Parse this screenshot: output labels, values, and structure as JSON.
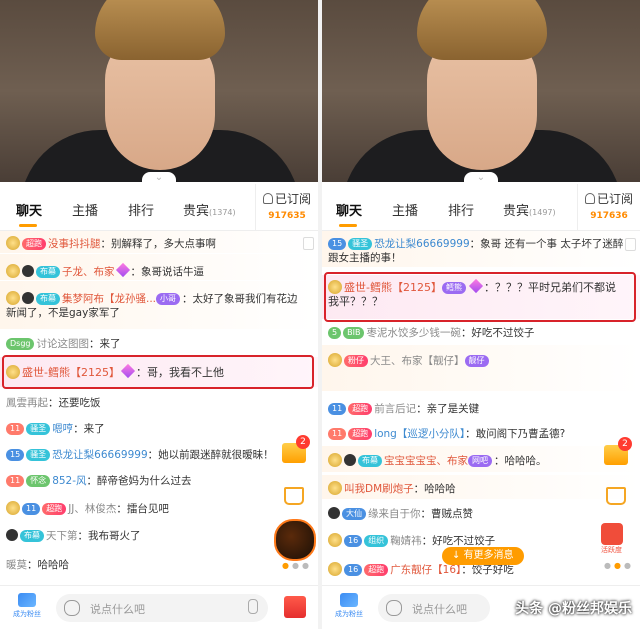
{
  "colors": {
    "accent": "#ff9c00",
    "highlight_border": "#d8232a",
    "subscribe_count": "#ff8a00"
  },
  "left": {
    "tabs": [
      {
        "label": "聊天",
        "active": true
      },
      {
        "label": "主播"
      },
      {
        "label": "排行"
      },
      {
        "label": "贵宾",
        "count": "(1374)"
      }
    ],
    "subscribe": {
      "label": "已订阅",
      "count": "917635"
    },
    "messages": [
      {
        "badge": "超跑",
        "name": "没事抖抖腿",
        "text": "：别解释了，多大点事啊"
      },
      {
        "badge": "布幕",
        "name": "子龙、布家",
        "text": "：象哥说话牛逼"
      },
      {
        "badge": "布幕",
        "name": "集梦阿布【龙孙骚...",
        "badge2": "小哥",
        "text": "：太好了象哥我们有花边新闻了，不是gay家军了"
      },
      {
        "badge": "Dsgg",
        "name": "讨论这图图",
        "text": "：来了"
      },
      {
        "name": "盛世-鳕熊【2125】",
        "text": "：哥，我看不上他"
      },
      {
        "name": "鳳雲再起",
        "text": "：还要吃饭"
      },
      {
        "badge": "骚圣",
        "name": "嗯哼",
        "text": "：来了"
      },
      {
        "badge": "骚圣",
        "name": "恐龙让梨66669999",
        "text": "：她以前跟迷醉就很暧昧！"
      },
      {
        "badge": "怀念",
        "name": "852-风",
        "text": "：醉帝爸妈为什么过去"
      },
      {
        "badge": "超跑",
        "name": "JJ、林俊杰",
        "text": "：擂台见吧"
      },
      {
        "badge": "布幕",
        "name": "天下第",
        "text": "：我布哥火了"
      },
      {
        "name": "暖莫",
        "text": "：哈哈哈"
      }
    ],
    "gift_count": "2",
    "input_placeholder": "说点什么吧",
    "fan_label": "成为粉丝"
  },
  "right": {
    "tabs": [
      {
        "label": "聊天",
        "active": true
      },
      {
        "label": "主播"
      },
      {
        "label": "排行"
      },
      {
        "label": "贵宾",
        "count": "(1497)"
      }
    ],
    "subscribe": {
      "label": "已订阅",
      "count": "917636"
    },
    "messages": [
      {
        "badge": "骚圣",
        "name": "恐龙让梨66669999",
        "text": "：象哥 还有一个事 太子坏了迷醉跟女主播的事！"
      },
      {
        "name": "盛世-鳕熊【2125】",
        "badge": "鳕熊",
        "text": "：？？？平时兄弟们不都说我平？？？"
      },
      {
        "badge": "BIB",
        "name": "枣泥水饺多少钱一碗",
        "text": "：好吃不过饺子"
      },
      {
        "badge": "粉仔",
        "name": "大王、布家【靓仔】",
        "badge2": "靓仔",
        "text": ""
      },
      {
        "badge": "超跑",
        "name": "前言后记",
        "text": "：亲了是关键"
      },
      {
        "badge": "超跑",
        "name": "long【巡逻小分队】",
        "text": "：敢问阁下乃曹孟德?"
      },
      {
        "badge": "布幕",
        "name": "宝宝宝宝宝、布家",
        "badge2": "网吧",
        "text": "：哈哈哈。"
      },
      {
        "name": "叫我DM刷炮子",
        "text": "：哈哈哈"
      },
      {
        "badge": "大仙",
        "name": "缘来自于你",
        "text": "：曹贼点赞"
      },
      {
        "badge": "组织",
        "name": "鞠婧祎",
        "text": "：好吃不过饺子"
      },
      {
        "badge": "超跑",
        "name": "广东靓仔【16】",
        "text": "：饺子好吃"
      }
    ],
    "gift_count": "2",
    "more_messages": "↓ 有更多消息",
    "mini_widget_label": "活跃度",
    "input_placeholder": "说点什么吧",
    "fan_label": "成为粉丝"
  },
  "watermark": "头条 @粉丝邦娱乐"
}
